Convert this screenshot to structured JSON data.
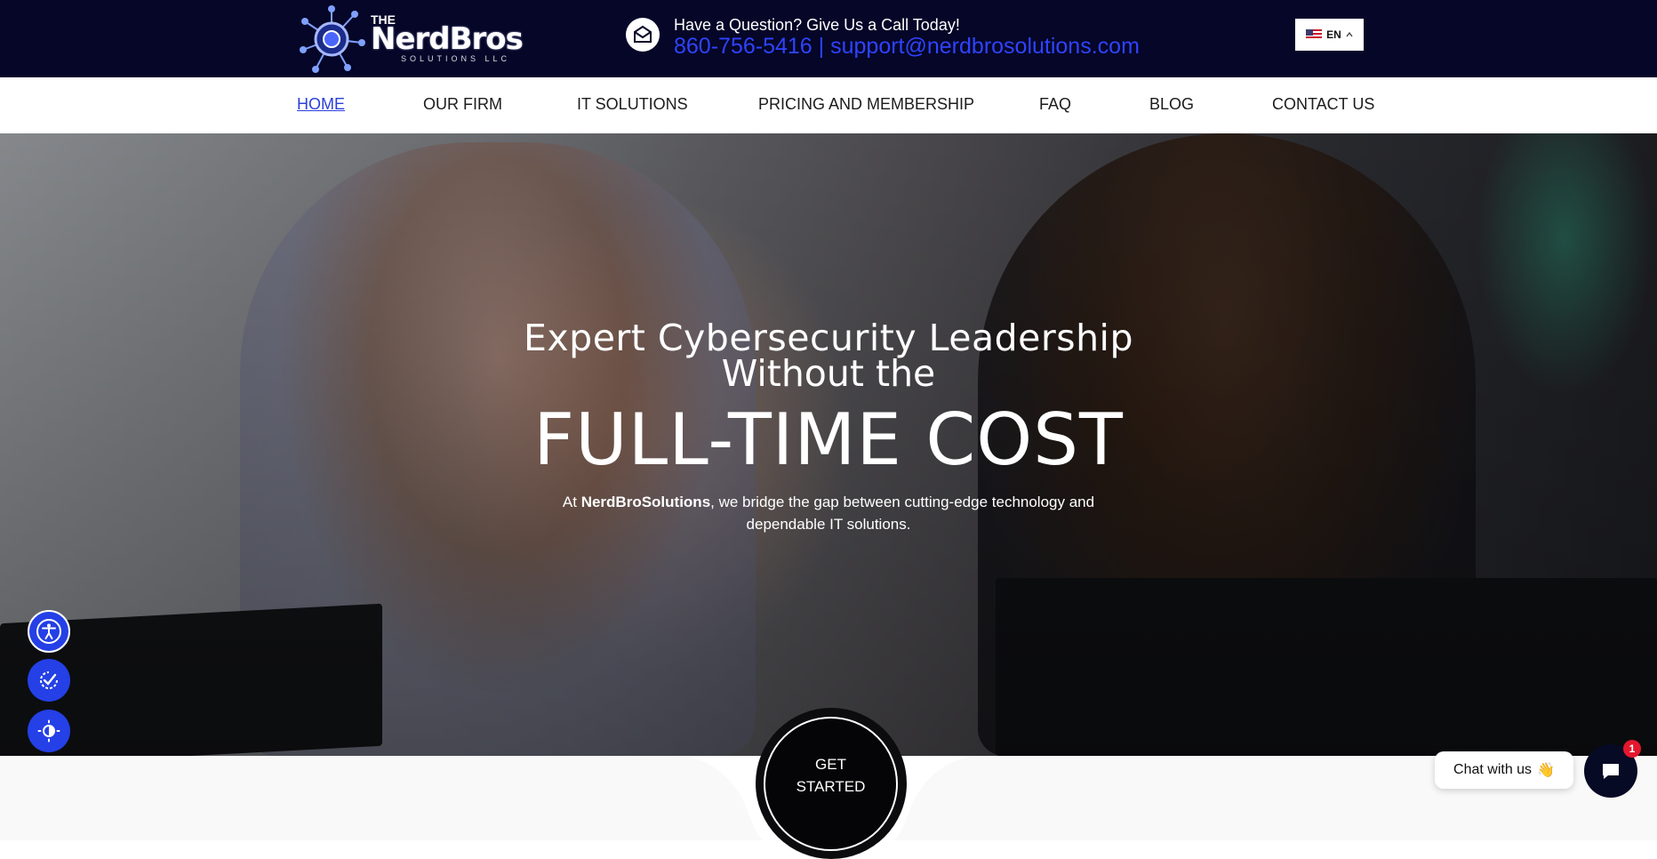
{
  "brand": {
    "logo_the": "THE",
    "logo_main": "NerdBros",
    "logo_sub": "SOLUTIONS LLC"
  },
  "contact": {
    "question": "Have a Question? Give Us a Call Today!",
    "phone": "860-756-5416",
    "separator": "|",
    "email": "support@nerdbrosolutions.com",
    "icon": "mail-icon"
  },
  "language": {
    "selected": "EN",
    "flag": "us-flag-icon",
    "caret": "chevron-up-icon"
  },
  "nav": {
    "items": [
      {
        "label": "HOME",
        "active": true
      },
      {
        "label": "OUR FIRM",
        "active": false
      },
      {
        "label": "IT SOLUTIONS",
        "active": false
      },
      {
        "label": "PRICING AND MEMBERSHIP",
        "active": false
      },
      {
        "label": "FAQ",
        "active": false
      },
      {
        "label": "BLOG",
        "active": false
      },
      {
        "label": "CONTACT US",
        "active": false
      }
    ]
  },
  "hero": {
    "title_line1": "Expert Cybersecurity Leadership",
    "title_line2": "Without the",
    "title_line3": "FULL-TIME COST",
    "desc_prefix": "At ",
    "desc_brand": "NerdBroSolutions",
    "desc_suffix": ", we bridge the gap between cutting-edge technology and dependable IT solutions.",
    "cta_line1": "GET",
    "cta_line2": "STARTED"
  },
  "accessibility": {
    "buttons": [
      "accessibility-icon",
      "reading-check-icon",
      "contrast-icon"
    ]
  },
  "chat": {
    "label": "Chat with us",
    "emoji": "👋",
    "badge": "1",
    "icon": "chat-bubble-icon"
  },
  "colors": {
    "topbar_bg": "#050628",
    "accent_blue": "#2f43ff",
    "nav_active": "#2b3fdc",
    "a11y_blue": "#2440e6",
    "chat_dark": "#060a24",
    "badge_red": "#e3172e"
  }
}
